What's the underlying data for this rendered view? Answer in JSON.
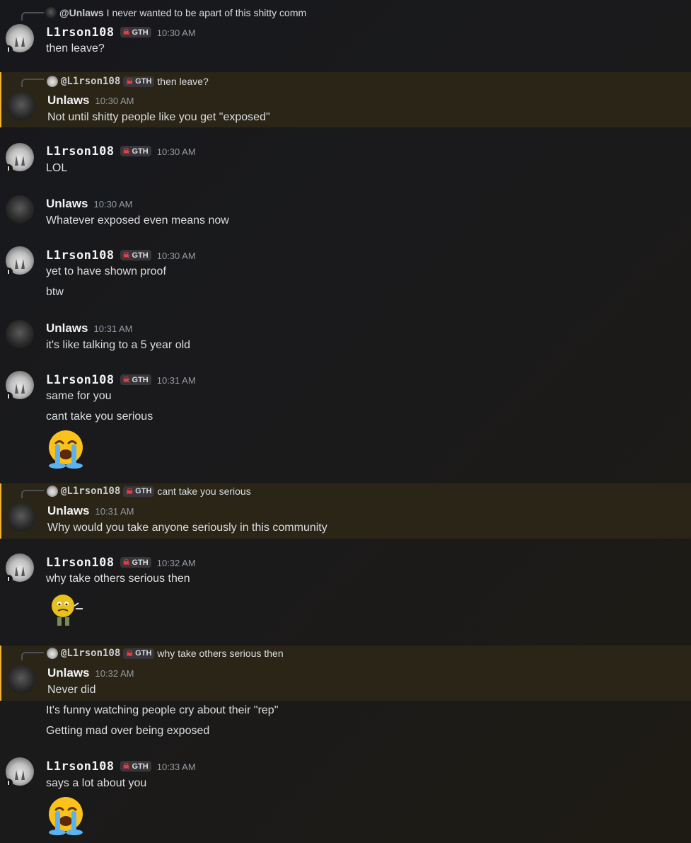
{
  "users": {
    "l": {
      "name": "L1rson108",
      "tag": "GTH"
    },
    "u": {
      "name": "Unlaws"
    }
  },
  "messages": [
    {
      "reply": {
        "name": "@Unlaws",
        "text": "I never wanted to be apart of this shitty comm"
      },
      "time": "10:30 AM",
      "lines": [
        "then leave?"
      ]
    },
    {
      "reply": {
        "name": "@L1rson108",
        "tag": "GTH",
        "text": "then leave?"
      },
      "time": "10:30 AM",
      "lines": [
        "Not until shitty people like you get \"exposed\""
      ]
    },
    {
      "time": "10:30 AM",
      "lines": [
        "LOL"
      ]
    },
    {
      "time": "10:30 AM",
      "lines": [
        "Whatever exposed even means now"
      ]
    },
    {
      "time": "10:30 AM",
      "lines": [
        "yet to have shown proof",
        "btw"
      ]
    },
    {
      "time": "10:31 AM",
      "lines": [
        "it's like talking to a 5 year old"
      ]
    },
    {
      "time": "10:31 AM",
      "lines": [
        "same for you",
        "cant take you serious"
      ],
      "emoji": "loudly-crying-face"
    },
    {
      "reply": {
        "name": "@L1rson108",
        "tag": "GTH",
        "text": "cant take you serious"
      },
      "time": "10:31 AM",
      "lines": [
        "Why would you take anyone seriously in this community"
      ]
    },
    {
      "time": "10:32 AM",
      "lines": [
        "why take others serious then"
      ],
      "emoji": "shrugging-smiley-meme"
    },
    {
      "reply": {
        "name": "@L1rson108",
        "tag": "GTH",
        "text": "why take others serious then"
      },
      "time": "10:32 AM",
      "lines": [
        "Never did",
        "It's funny watching people cry about their \"rep\"",
        "Getting mad over being exposed"
      ]
    },
    {
      "time": "10:33 AM",
      "lines": [
        "says a lot about you"
      ],
      "emoji": "loudly-crying-face"
    }
  ],
  "colors": {
    "mention_bg": "#2a2516",
    "mention_bar": "#f0b232",
    "tag_skull": "#f23f43",
    "timestamp": "#949ba4"
  }
}
